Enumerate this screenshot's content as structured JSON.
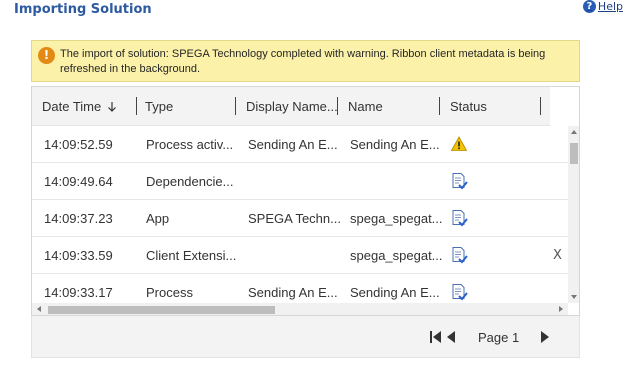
{
  "header": {
    "title": "Importing Solution",
    "help_label": "Help"
  },
  "banner": {
    "message": "The import of solution: SPEGA Technology completed with warning. Ribbon client metadata is being refreshed in the background."
  },
  "grid": {
    "columns": [
      "Date Time",
      "Type",
      "Display Name...",
      "Name",
      "Status"
    ],
    "rows": [
      {
        "time": "14:09:52.59",
        "type": "Process activ...",
        "display_name": "Sending An E...",
        "name": "Sending An E...",
        "status": "warning-icon"
      },
      {
        "time": "14:09:49.64",
        "type": "Dependencie...",
        "display_name": "",
        "name": "",
        "status": "success-doc-icon"
      },
      {
        "time": "14:09:37.23",
        "type": "App",
        "display_name": "SPEGA Techn...",
        "name": "spega_spegat...",
        "status": "success-doc-icon"
      },
      {
        "time": "14:09:33.59",
        "type": "Client Extensi...",
        "display_name": "",
        "name": "spega_spegat...",
        "status": "success-doc-icon",
        "extra": "X"
      },
      {
        "time": "14:09:33.17",
        "type": "Process",
        "display_name": "Sending An E...",
        "name": "Sending An E...",
        "status": "success-doc-icon"
      }
    ]
  },
  "pager": {
    "page_label": "Page 1"
  },
  "colors": {
    "title": "#2d5aa0",
    "banner_bg": "#fbf1a9",
    "warning": "#e38a15",
    "header_bg": "#f3f3f3"
  }
}
